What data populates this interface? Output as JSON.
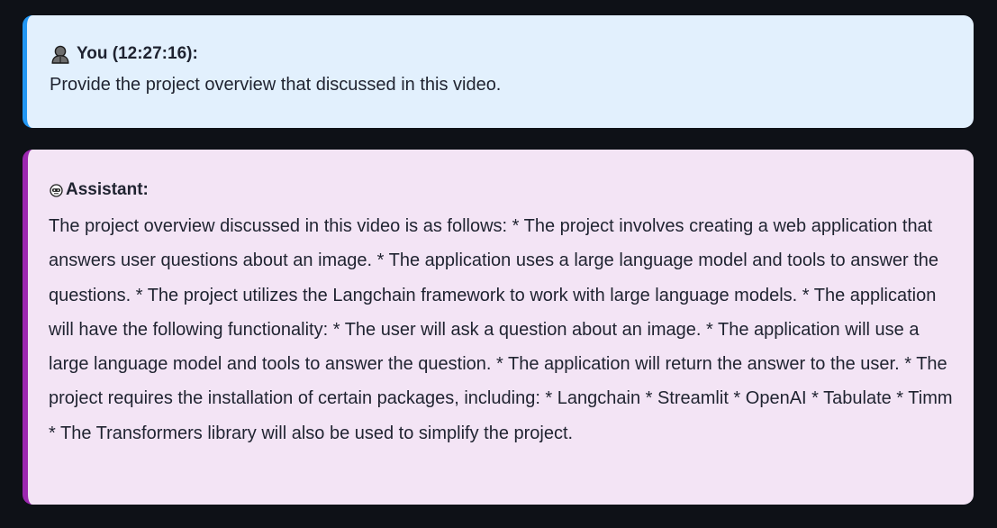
{
  "messages": {
    "user": {
      "icon": "person-icon",
      "header": "You (12:27:16):",
      "text": "Provide the project overview that discussed in this video."
    },
    "assistant": {
      "icon": "robot-icon",
      "header": "Assistant:",
      "text": "The project overview discussed in this video is as follows: * The project involves creating a web application that answers user questions about an image. * The application uses a large language model and tools to answer the questions. * The project utilizes the Langchain framework to work with large language models. * The application will have the following functionality: * The user will ask a question about an image. * The application will use a large language model and tools to answer the question. * The application will return the answer to the user. * The project requires the installation of certain packages, including: * Langchain * Streamlit * OpenAI * Tabulate * Timm * The Transformers library will also be used to simplify the project."
    }
  },
  "colors": {
    "page_background": "#0e1117",
    "user_bubble": "#e2f0fd",
    "user_accent": "#2196f3",
    "assistant_bubble": "#f3e4f5",
    "assistant_accent": "#9c27b0",
    "text": "#1f2330"
  }
}
